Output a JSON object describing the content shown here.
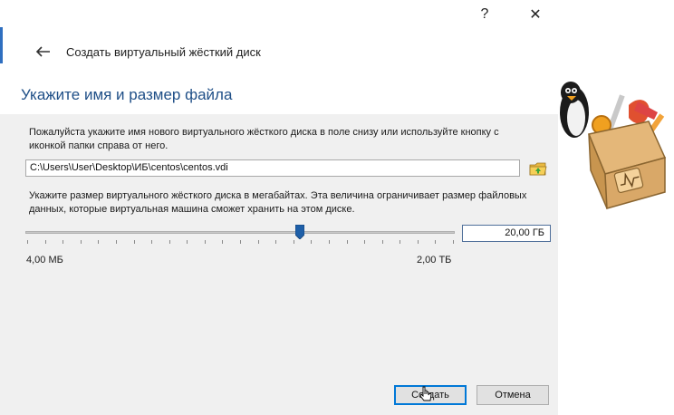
{
  "titlebar": {
    "help_label": "?",
    "close_label": "✕"
  },
  "header": {
    "title": "Создать виртуальный жёсткий диск"
  },
  "section": {
    "title": "Укажите имя и размер файла"
  },
  "file": {
    "description": "Пожалуйста укажите имя нового виртуального жёсткого диска в поле снизу или используйте кнопку с иконкой папки справа от него.",
    "path_value": "C:\\Users\\User\\Desktop\\ИБ\\centos\\centos.vdi"
  },
  "size": {
    "description": "Укажите размер виртуального жёсткого диска в мегабайтах. Эта величина ограничивает размер файловых данных, которые виртуальная машина сможет хранить на этом диске.",
    "value": "20,00 ГБ",
    "min_label": "4,00 МБ",
    "max_label": "2,00 ТБ",
    "slider_fraction": 0.64
  },
  "buttons": {
    "create": "Создать",
    "cancel": "Отмена"
  },
  "colors": {
    "accent": "#0078d7",
    "title_blue": "#1f4f87"
  },
  "icons": [
    "help-icon",
    "close-icon",
    "back-arrow-icon",
    "folder-icon",
    "mascot-toolbox-icon"
  ]
}
